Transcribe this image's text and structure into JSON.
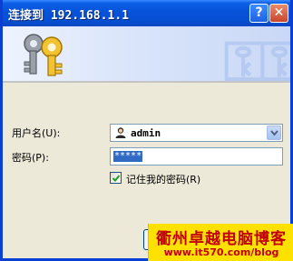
{
  "window": {
    "title": "连接到 192.168.1.1",
    "help_button": "?",
    "close_button": "✕"
  },
  "form": {
    "username_label": "用户名(U):",
    "username_value": "admin",
    "password_label": "密码(P):",
    "password_mask": "*****",
    "remember_label": "记住我的密码(R)",
    "remember_checked": true
  },
  "watermark": {
    "title": "衢州卓越电脑博客",
    "url": "www.it570.com/blog"
  },
  "colors": {
    "titlebar": "#0550d4",
    "dialog_bg": "#ece9d8",
    "watermark_bg": "#ffe100",
    "watermark_text": "#c0000f"
  },
  "icons": {
    "banner": "keys-icon",
    "user": "user-icon",
    "dropdown": "chevron-down-icon"
  }
}
